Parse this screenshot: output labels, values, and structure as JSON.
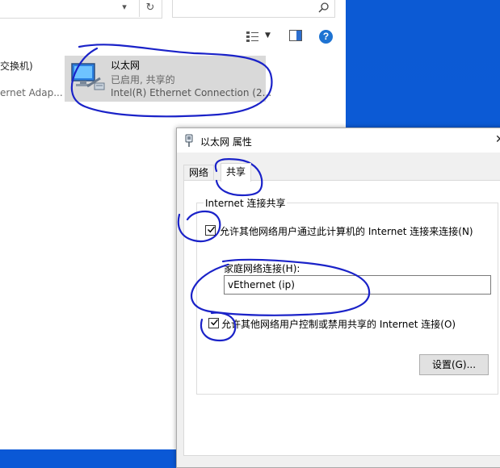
{
  "explorer": {
    "left_items": {
      "line1": "交换机)",
      "line2": "ernet Adap..."
    },
    "adapter": {
      "name": "以太网",
      "status": "已启用, 共享的",
      "device": "Intel(R) Ethernet Connection (2..."
    },
    "icons": {
      "refresh": "refresh-icon",
      "chevron": "chevron-down-icon",
      "search": "search-icon",
      "view": "view-options-icon",
      "pane": "preview-pane-icon",
      "help": "?"
    }
  },
  "dialog": {
    "title": "以太网 属性",
    "close": "✕",
    "tabs": [
      {
        "label": "网络"
      },
      {
        "label": "共享",
        "selected": true
      }
    ],
    "group_title": "Internet 连接共享",
    "allow_sharing": {
      "checked": true,
      "label": "允许其他网络用户通过此计算机的 Internet 连接来连接(N)"
    },
    "home_network": {
      "label": "家庭网络连接(H):",
      "value": "vEthernet (ip)"
    },
    "allow_control": {
      "checked": true,
      "label": "允许其他网络用户控制或禁用共享的 Internet 连接(O)"
    },
    "settings_button": "设置(G)..."
  },
  "colors": {
    "desktop": "#0a58d6",
    "ink": "#1a22c8",
    "help_blue": "#1e73d2"
  }
}
